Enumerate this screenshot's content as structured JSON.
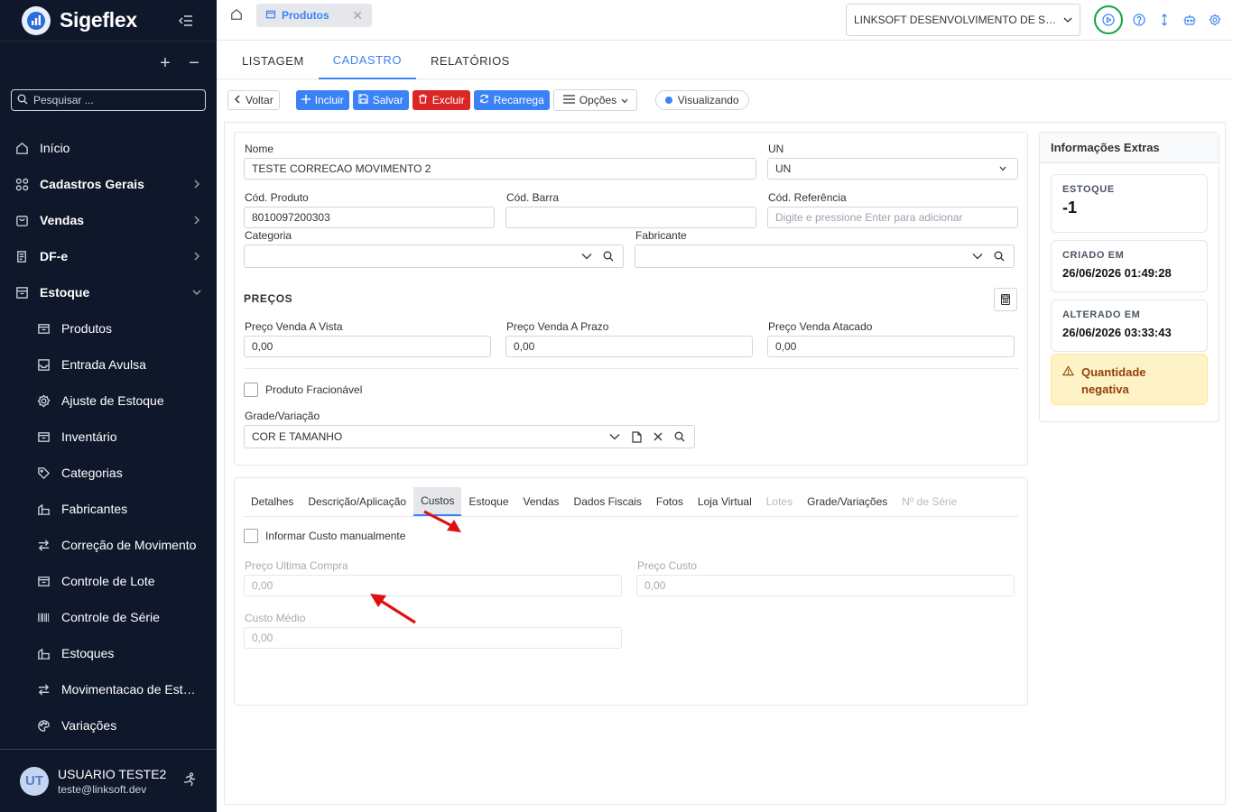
{
  "sidebar": {
    "brand": "Sigeflex",
    "tree_expand_symbol": "+",
    "tree_collapse_symbol": "−",
    "search_placeholder": "Pesquisar ...",
    "items": [
      {
        "label": "Início",
        "icon": "home-icon"
      },
      {
        "label": "Cadastros Gerais",
        "icon": "grid-icon"
      },
      {
        "label": "Vendas",
        "icon": "cart-icon"
      },
      {
        "label": "DF-e",
        "icon": "document-icon"
      },
      {
        "label": "Estoque",
        "icon": "archive-icon"
      }
    ],
    "sub_items": [
      {
        "label": "Produtos",
        "icon": "box-icon"
      },
      {
        "label": "Entrada Avulsa",
        "icon": "inbox-icon"
      },
      {
        "label": "Ajuste de Estoque",
        "icon": "gear-icon"
      },
      {
        "label": "Inventário",
        "icon": "box-icon"
      },
      {
        "label": "Categorias",
        "icon": "tag-icon"
      },
      {
        "label": "Fabricantes",
        "icon": "building-icon"
      },
      {
        "label": "Correção de Movimento",
        "icon": "swap-icon"
      },
      {
        "label": "Controle de Lote",
        "icon": "box-icon"
      },
      {
        "label": "Controle de Série",
        "icon": "barcode-icon"
      },
      {
        "label": "Estoques",
        "icon": "building-icon"
      },
      {
        "label": "Movimentacao de Estoque",
        "icon": "swap-icon"
      },
      {
        "label": "Variações",
        "icon": "palette-icon"
      }
    ],
    "user": {
      "initials": "UT",
      "name": "USUARIO TESTE2",
      "email": "teste@linksoft.dev"
    }
  },
  "topbar": {
    "doc_tab": "Produtos",
    "company": "LINKSOFT DESENVOLVIMENTO DE SOFTWARE"
  },
  "main_tabs": [
    "LISTAGEM",
    "CADASTRO",
    "RELATÓRIOS"
  ],
  "toolbar": {
    "back": "Voltar",
    "include": "Incluir",
    "save": "Salvar",
    "delete": "Excluir",
    "reload": "Recarrega",
    "options": "Opções",
    "status": "Visualizando"
  },
  "form": {
    "nome_label": "Nome",
    "nome_value": "TESTE CORRECAO MOVIMENTO 2",
    "un_label": "UN",
    "un_value": "UN",
    "cod_produto_label": "Cód. Produto",
    "cod_produto_value": "8010097200303",
    "cod_barra_label": "Cód. Barra",
    "cod_barra_value": "",
    "cod_ref_label": "Cód. Referência",
    "cod_ref_placeholder": "Digite e pressione Enter para adicionar",
    "categoria_label": "Categoria",
    "fabricante_label": "Fabricante",
    "precos_title": "PREÇOS",
    "preco_vista_label": "Preço Venda A Vista",
    "preco_vista_value": "0,00",
    "preco_prazo_label": "Preço Venda A Prazo",
    "preco_prazo_value": "0,00",
    "preco_atacado_label": "Preço Venda Atacado",
    "preco_atacado_value": "0,00",
    "fracionavel_label": "Produto Fracionável",
    "grade_label": "Grade/Variação",
    "grade_value": "COR E TAMANHO"
  },
  "sub_tabs": [
    {
      "label": "Detalhes",
      "state": "normal"
    },
    {
      "label": "Descrição/Aplicação",
      "state": "normal"
    },
    {
      "label": "Custos",
      "state": "active"
    },
    {
      "label": "Estoque",
      "state": "normal"
    },
    {
      "label": "Vendas",
      "state": "normal"
    },
    {
      "label": "Dados Fiscais",
      "state": "normal"
    },
    {
      "label": "Fotos",
      "state": "normal"
    },
    {
      "label": "Loja Virtual",
      "state": "normal"
    },
    {
      "label": "Lotes",
      "state": "disabled"
    },
    {
      "label": "Grade/Variações",
      "state": "normal"
    },
    {
      "label": "Nº de Série",
      "state": "disabled"
    }
  ],
  "costs": {
    "manual_label": "Informar Custo manualmente",
    "ultima_compra_label": "Preço Ultima Compra",
    "ultima_compra_value": "0,00",
    "preco_custo_label": "Preço Custo",
    "preco_custo_value": "0,00",
    "custo_medio_label": "Custo Médio",
    "custo_medio_value": "0,00"
  },
  "extra": {
    "title": "Informações Extras",
    "estoque_caption": "ESTOQUE",
    "estoque_value": "-1",
    "criado_caption": "CRIADO EM",
    "criado_value": "26/06/2026 01:49:28",
    "alterado_caption": "ALTERADO EM",
    "alterado_value": "26/06/2026 03:33:43",
    "warning": "Quantidade negativa"
  },
  "colors": {
    "accent": "#3b82f6",
    "danger": "#dc2626",
    "sidebar_bg": "#0f172a",
    "warning_bg": "#fef3c7",
    "annotation_arrow": "#e01010"
  }
}
